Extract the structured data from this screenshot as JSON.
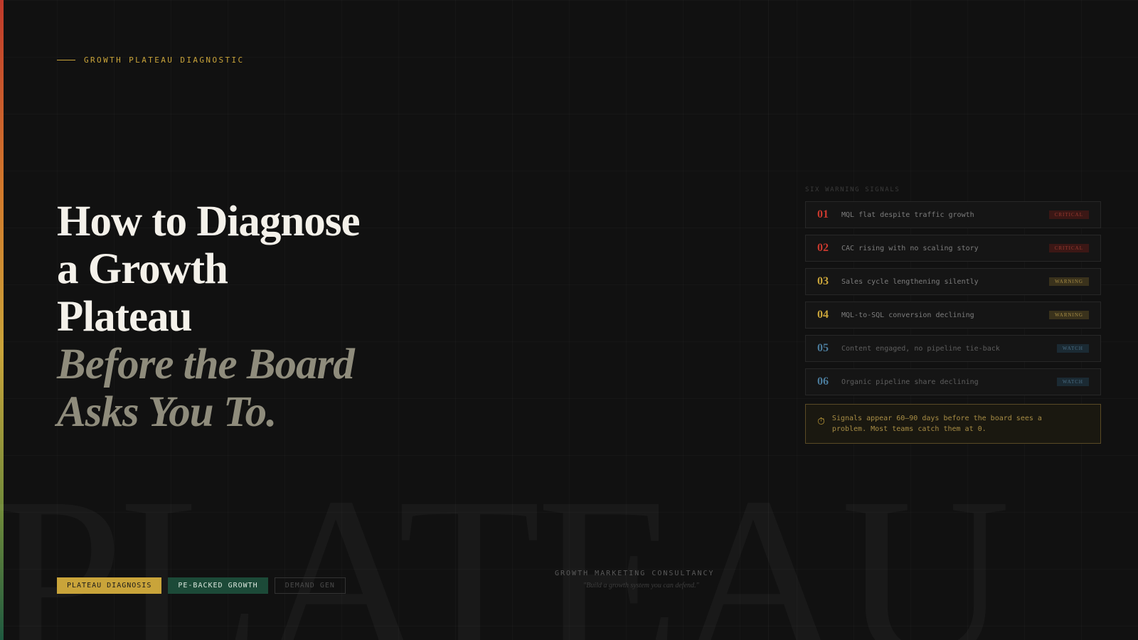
{
  "eyebrow": "GROWTH PLATEAU DIAGNOSTIC",
  "headline": {
    "line1": "How to Diagnose",
    "line2": "a Growth",
    "line3": "Plateau",
    "italic1": "Before the Board",
    "italic2": "Asks You To."
  },
  "watermark": "PLATEAU",
  "panel": {
    "label": "SIX WARNING SIGNALS",
    "signals": [
      {
        "num": "01",
        "text": "MQL flat despite traffic growth",
        "badge": "CRITICAL"
      },
      {
        "num": "02",
        "text": "CAC rising with no scaling story",
        "badge": "CRITICAL"
      },
      {
        "num": "03",
        "text": "Sales cycle lengthening silently",
        "badge": "WARNING"
      },
      {
        "num": "04",
        "text": "MQL-to-SQL conversion declining",
        "badge": "WARNING"
      },
      {
        "num": "05",
        "text": "Content engaged, no pipeline tie-back",
        "badge": "WATCH"
      },
      {
        "num": "06",
        "text": "Organic pipeline share declining",
        "badge": "WATCH"
      }
    ],
    "notice": {
      "icon": "⏱",
      "line1": "Signals appear 60–90 days before the board sees a",
      "line2": "problem. Most teams catch them at 0."
    }
  },
  "tags": [
    "PLATEAU DIAGNOSIS",
    "PE-BACKED GROWTH",
    "DEMAND GEN"
  ],
  "footer": {
    "name": "GROWTH MARKETING CONSULTANCY",
    "quote": "\"Build a growth system you can defend.\""
  },
  "colors": {
    "critical": "#c9392e",
    "warning": "#c9a43a",
    "watch": "#4a7a9a",
    "gold": "#c9a43a",
    "green": "#1c4a38"
  }
}
